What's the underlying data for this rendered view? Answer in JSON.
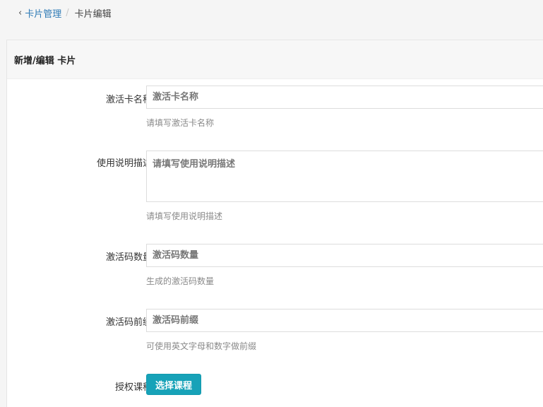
{
  "breadcrumb": {
    "back_icon": "chevron-left-icon",
    "parent": "卡片管理",
    "separator": "/",
    "current": "卡片编辑"
  },
  "card": {
    "title": "新增/编辑 卡片"
  },
  "form": {
    "name": {
      "label": "激活卡名称",
      "placeholder": "激活卡名称",
      "value": "",
      "hint": "请填写激活卡名称"
    },
    "description": {
      "label": "使用说明描述",
      "placeholder": "请填写使用说明描述",
      "value": "",
      "hint": "请填写使用说明描述"
    },
    "quantity": {
      "label": "激活码数量",
      "placeholder": "激活码数量",
      "value": "",
      "hint": "生成的激活码数量"
    },
    "prefix": {
      "label": "激活码前缀",
      "placeholder": "激活码前缀",
      "value": "",
      "hint": "可使用英文字母和数字做前缀"
    },
    "courses": {
      "label": "授权课程",
      "button_label": "选择课程"
    }
  },
  "colors": {
    "accent": "#17a2b8",
    "link": "#2f7bb6"
  }
}
